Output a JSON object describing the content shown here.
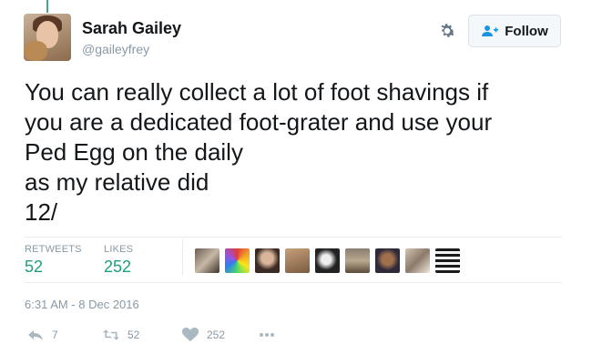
{
  "user": {
    "display_name": "Sarah Gailey",
    "handle": "@gaileyfrey"
  },
  "follow_button": {
    "label": "Follow"
  },
  "tweet": {
    "text": "You can really collect a lot of foot shavings if\nyou are a dedicated foot-grater and use your\nPed Egg on the daily\nas my relative did\n12/"
  },
  "stats": {
    "retweets_label": "RETWEETS",
    "retweets_value": "52",
    "likes_label": "LIKES",
    "likes_value": "252"
  },
  "likers": [
    {
      "icon": "liker-avatar-1"
    },
    {
      "icon": "liker-avatar-2"
    },
    {
      "icon": "liker-avatar-3"
    },
    {
      "icon": "liker-avatar-4"
    },
    {
      "icon": "liker-avatar-5"
    },
    {
      "icon": "liker-avatar-6"
    },
    {
      "icon": "liker-avatar-7"
    },
    {
      "icon": "liker-avatar-8"
    },
    {
      "icon": "liker-avatar-9"
    }
  ],
  "timestamp": "6:31 AM - 8 Dec 2016",
  "actions": {
    "reply_count": "7",
    "retweet_count": "52",
    "like_count": "252"
  },
  "colors": {
    "thread_line": "#44a391",
    "stat_value": "#1f9e7f",
    "muted": "#8899a6"
  }
}
